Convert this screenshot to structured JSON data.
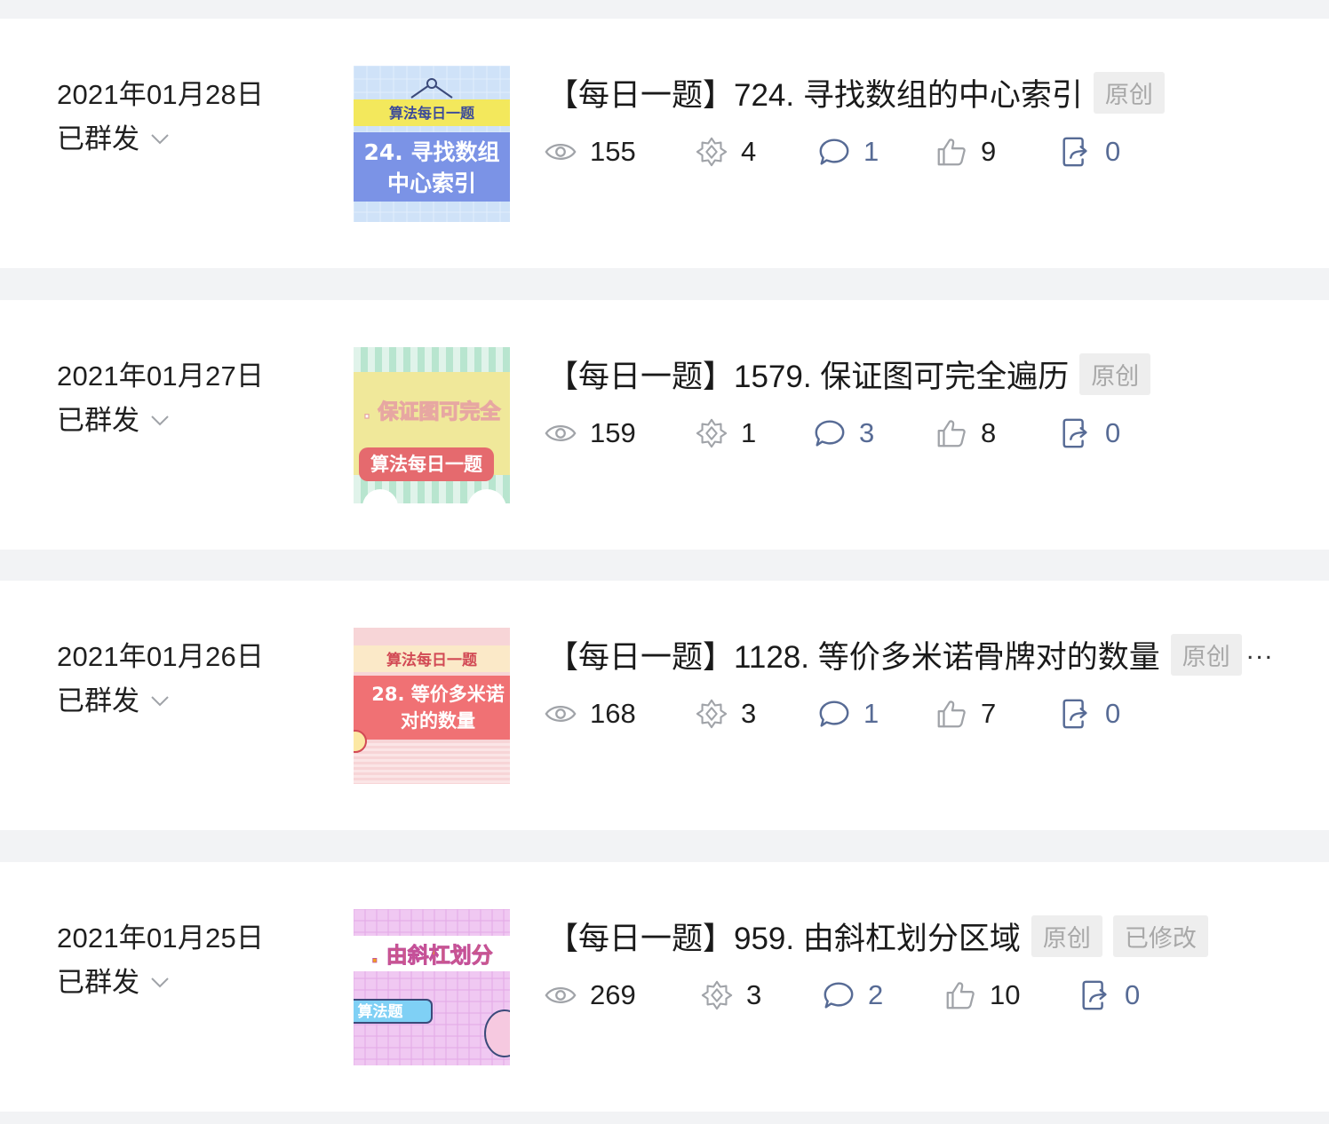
{
  "articles": [
    {
      "date": "2021年01月28日",
      "status": "已群发",
      "title": "【每日一题】724. 寻找数组的中心索引",
      "tags": [
        "原创"
      ],
      "has_more": false,
      "stats": {
        "views": "155",
        "wow": "4",
        "comments": "1",
        "likes": "9",
        "shares": "0"
      },
      "thumb": {
        "theme": "blue",
        "line1": "算法每日一题",
        "line2": "24. 寻找数组",
        "line3": "中心索引"
      }
    },
    {
      "date": "2021年01月27日",
      "status": "已群发",
      "title": "【每日一题】1579. 保证图可完全遍历",
      "tags": [
        "原创"
      ],
      "has_more": false,
      "stats": {
        "views": "159",
        "wow": "1",
        "comments": "3",
        "likes": "8",
        "shares": "0"
      },
      "thumb": {
        "theme": "yellow",
        "line1": ". 保证图可完全",
        "line2": "算法每日一题",
        "line3": ""
      }
    },
    {
      "date": "2021年01月26日",
      "status": "已群发",
      "title": "【每日一题】1128. 等价多米诺骨牌对的数量",
      "tags": [
        "原创"
      ],
      "has_more": true,
      "more_label": "...",
      "stats": {
        "views": "168",
        "wow": "3",
        "comments": "1",
        "likes": "7",
        "shares": "0"
      },
      "thumb": {
        "theme": "red",
        "line1": "算法每日一题",
        "line2": "28. 等价多米诺",
        "line3": "对的数量"
      }
    },
    {
      "date": "2021年01月25日",
      "status": "已群发",
      "title": "【每日一题】959. 由斜杠划分区域",
      "tags": [
        "原创",
        "已修改"
      ],
      "has_more": false,
      "stats": {
        "views": "269",
        "wow": "3",
        "comments": "2",
        "likes": "10",
        "shares": "0"
      },
      "thumb": {
        "theme": "pink",
        "line1": ". 由斜杠划分",
        "line2": "算法题",
        "line3": ""
      }
    }
  ],
  "icons": {
    "views": "eye-icon",
    "wow": "wow-icon",
    "comments": "comment-icon",
    "likes": "thumbs-up-icon",
    "shares": "share-icon",
    "status_toggle": "chevron-down-icon"
  },
  "colors": {
    "page_background": "#f2f3f5",
    "card_background": "#ffffff",
    "stat_blue": "#576b95",
    "tag_background": "#eeeeee",
    "tag_text": "#a8a8a8"
  }
}
